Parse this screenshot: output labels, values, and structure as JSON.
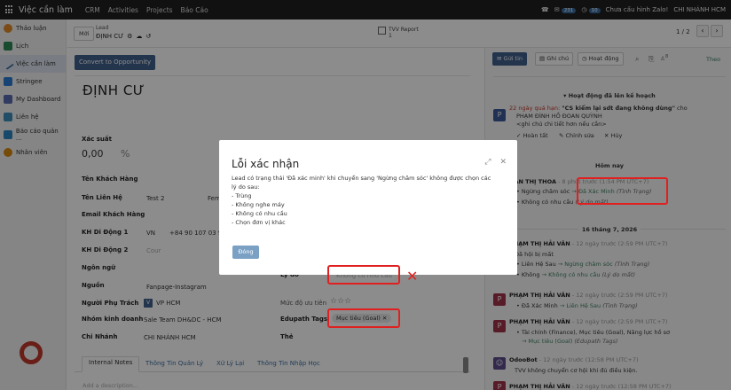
{
  "topbar": {
    "app_name": "Việc cần làm",
    "menus": [
      "CRM",
      "Activities",
      "Projects",
      "Báo Cáo"
    ],
    "badge_messages": "231",
    "badge_activities": "10",
    "zalo_status": "Chưa cấu hình Zalo!",
    "company": "CHI NHÁNH HCM"
  },
  "sidebar": {
    "items": [
      {
        "label": "Thảo luận",
        "color": "#e08a2b"
      },
      {
        "label": "Lịch",
        "color": "#2e8b57"
      },
      {
        "label": "Việc cần làm",
        "color": "#3c6e9e"
      },
      {
        "label": "Stringee",
        "color": "#2c7bd6"
      },
      {
        "label": "My Dashboard",
        "color": "#5a6bb0"
      },
      {
        "label": "Liên hệ",
        "color": "#3c8dbc"
      },
      {
        "label": "Báo cáo quản ...",
        "color": "#2e86c1"
      },
      {
        "label": "Nhân viên",
        "color": "#d68910"
      }
    ]
  },
  "control_panel": {
    "new_button": "Mới",
    "breadcrumb_parent": "Lead",
    "breadcrumb_current": "ĐỊNH CƯ",
    "report_name": "TVV Report",
    "report_count": "1",
    "pager": "1 / 2"
  },
  "form": {
    "convert_button": "Convert to Opportunity",
    "lead_name": "ĐỊNH CƯ",
    "probability_label": "Xác suất",
    "probability_value": "0,00",
    "probability_unit": "%",
    "customer_name_label": "Tên Khách Hàng",
    "contact_name_label": "Tên Liên Hệ",
    "contact_name_value": "Test 2",
    "contact_name_extra": "Fem",
    "email_label": "Email Khách Hàng",
    "phone1_label": "KH Di Động 1",
    "phone1_country": "VN",
    "phone1_value": "+84 90 107 03 9",
    "phone2_label": "KH Di Động 2",
    "phone2_country_placeholder": "Cour",
    "language_label": "Ngôn ngữ",
    "source_label": "Nguồn",
    "source_value": "Fanpage-Instagram",
    "owner_label": "Người Phụ Trách",
    "owner_chip": "V",
    "owner_value": "VP HCM",
    "sales_team_label": "Nhóm kinh doanh",
    "sales_team_value": "Sale Team DH&DC - HCM",
    "branch_label": "Chi Nhánh",
    "branch_value": "CHI NHÁNH HCM",
    "reason_label": "Lý do",
    "reason_placeholder": "Không có nhu cầu",
    "priority_label": "Mức độ ưu tiên",
    "priority_stars": "☆☆☆",
    "edupath_label": "Edupath Tags",
    "edupath_tag": "Mục tiêu (Goal)",
    "the_label": "Thẻ",
    "tabs": [
      "Internal Notes",
      "Thông Tin Quản Lý",
      "Xử Lý Lại",
      "Thông Tin Nhập Học"
    ],
    "description_placeholder": "Add a description..."
  },
  "chatter": {
    "send_button": "Gửi tin",
    "note_button": "Ghi chú",
    "activity_button": "Hoạt động",
    "follower_count": "8",
    "follow_label": "Theo",
    "planned_title": "Hoạt động đã lên kế hoạch",
    "planned_overdue": "22 ngày quá hạn:",
    "planned_task": "\"CS kiểm lại sdt đang không dùng\"",
    "planned_for": "cho",
    "planned_assignee": "PHẠM ĐÌNH HỒ ĐOAN QUỲNH",
    "planned_note": "<ghi chú chi tiết hơn nếu cần>",
    "planned_done": "Hoàn tất",
    "planned_edit": "Chỉnh sửa",
    "planned_cancel": "Hủy",
    "today_title": "Hôm nay",
    "m1_author": "ĐÀN THỊ THOA",
    "m1_time": "- 8 phút trước (1:54 PM UTC+7)",
    "m1_line1_from": "Ngừng chăm sóc",
    "m1_line1_to": "Đã Xác Minh",
    "m1_line1_field": "(Tình Trạng)",
    "m1_line2_from": "Không có nhu cầu",
    "m1_line2_field": "(Lý do mất)",
    "date_title": "16 tháng 7, 2026",
    "m2_author": "PHẠM THỊ HẢI VÂN",
    "m2_time": "- 12 ngày trước (2:59 PM UTC+7)",
    "m2_body": "Đã hội bị mất",
    "m2_line1_from": "Liên Hệ Sau",
    "m2_line1_to": "Ngừng chăm sóc",
    "m2_line1_field": "(Tình Trạng)",
    "m2_line2_from": "Không",
    "m2_line2_to": "Không có nhu cầu",
    "m2_line2_field": "(Lý do mất)",
    "m3_author": "PHẠM THỊ HẢI VÂN",
    "m3_time": "- 12 ngày trước (2:59 PM UTC+7)",
    "m3_line1_from": "Đã Xác Minh",
    "m3_line1_to": "Liên Hệ Sau",
    "m3_line1_field": "(Tình Trạng)",
    "m4_author": "PHẠM THỊ HẢI VÂN",
    "m4_time": "- 12 ngày trước (2:59 PM UTC+7)",
    "m4_line1": "Tài chính (Finance), Mục tiêu (Goal), Năng lực hồ sơ",
    "m4_line2_to": "Mục tiêu (Goal)",
    "m4_line2_field": "(Edupath Tags)",
    "m5_author": "OdooBot",
    "m5_time": "- 12 ngày trước (12:58 PM UTC+7)",
    "m5_body": "TVV không chuyển cơ hội khi đủ điều kiện.",
    "m6_author": "PHẠM THỊ HẢI VÂN",
    "m6_time": "- 12 ngày trước (12:58 PM UTC+7)",
    "avatar_letter": "P",
    "avatar_color": "#a0334a"
  },
  "dialog": {
    "title": "Lỗi xác nhận",
    "message": "Lead có trạng thái 'Đã xác minh' khi chuyển sang 'Ngừng chăm sóc' không được chọn các",
    "message_cont": "lý do sau:",
    "reasons": [
      "- Trùng",
      "- Không nghe máy",
      "- Không có nhu cầu",
      "- Chọn đơn vị khác"
    ],
    "close_button": "Đóng"
  },
  "annotations": {
    "cross_mark": "✕"
  }
}
